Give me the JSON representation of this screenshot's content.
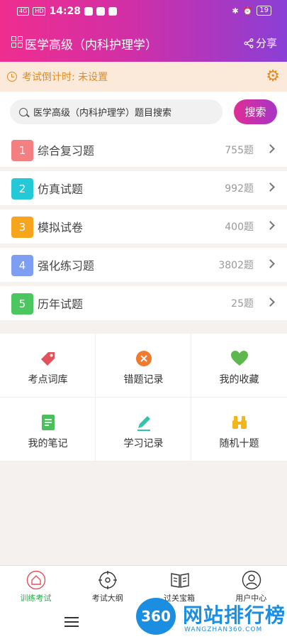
{
  "status_bar": {
    "network": "4G",
    "hd": "HD",
    "time": "14:28",
    "battery": "19"
  },
  "header": {
    "title": "医学高级（内科护理学）",
    "share_label": "分享"
  },
  "countdown": {
    "text": "考试倒计时: 未设置"
  },
  "search": {
    "placeholder": "医学高级（内科护理学）题目搜索",
    "button_label": "搜索"
  },
  "question_sets": [
    {
      "number": "1",
      "label": "综合复习题",
      "count": "755题",
      "color": "#f47f83"
    },
    {
      "number": "2",
      "label": "仿真试题",
      "count": "992题",
      "color": "#23c9d6"
    },
    {
      "number": "3",
      "label": "模拟试卷",
      "count": "400题",
      "color": "#f7a51d"
    },
    {
      "number": "4",
      "label": "强化练习题",
      "count": "3802题",
      "color": "#7e9ef2"
    },
    {
      "number": "5",
      "label": "历年试题",
      "count": "25题",
      "color": "#4cc65f"
    }
  ],
  "tools": [
    {
      "label": "考点词库",
      "icon": "tag-icon",
      "color": "#e2525b"
    },
    {
      "label": "错题记录",
      "icon": "close-circle-icon",
      "color": "#f07a2f"
    },
    {
      "label": "我的收藏",
      "icon": "heart-icon",
      "color": "#5cb84d"
    },
    {
      "label": "我的笔记",
      "icon": "notebook-icon",
      "color": "#4cbf5c"
    },
    {
      "label": "学习记录",
      "icon": "pencil-icon",
      "color": "#34c3a8"
    },
    {
      "label": "随机十题",
      "icon": "binoculars-icon",
      "color": "#f2b51c"
    }
  ],
  "tabs": [
    {
      "label": "训练考试",
      "icon": "home-icon",
      "active": true
    },
    {
      "label": "考试大纲",
      "icon": "compass-icon",
      "active": false
    },
    {
      "label": "过关宝箱",
      "icon": "book-icon",
      "active": false
    },
    {
      "label": "用户中心",
      "icon": "user-icon",
      "active": false
    }
  ],
  "watermark": {
    "logo_text": "360",
    "title": "网站排行榜",
    "url": "WANGZHAN360.COM"
  },
  "colors": {
    "header_gradient_start": "#ef2d8f",
    "header_gradient_end": "#8a3fd6",
    "countdown_bg": "#fbead9",
    "countdown_text": "#e58a1f",
    "active_tab": "#2fa84f"
  }
}
